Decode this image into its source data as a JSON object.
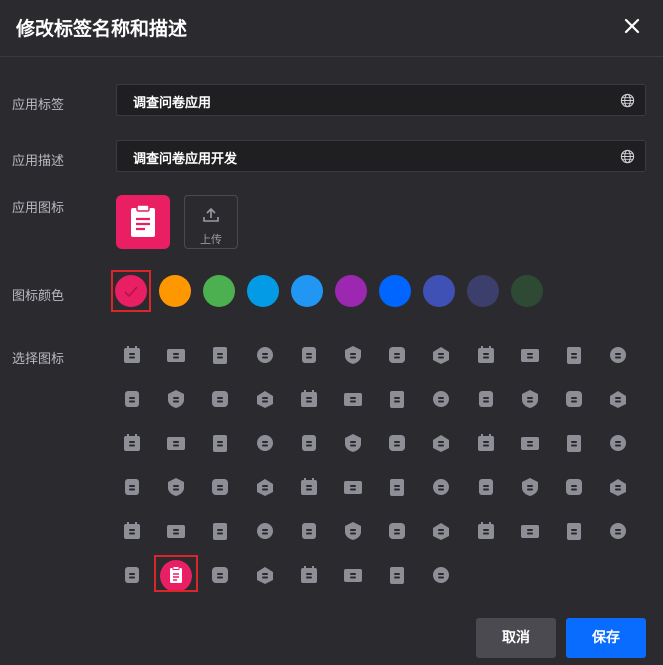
{
  "dialog": {
    "title": "修改标签名称和描述"
  },
  "fields": {
    "app_label": {
      "label": "应用标签",
      "value": "调查问卷应用"
    },
    "app_desc": {
      "label": "应用描述",
      "value": "调查问卷应用开发"
    },
    "app_icon": {
      "label": "应用图标",
      "upload_label": "上传"
    },
    "icon_color": {
      "label": "图标颜色"
    },
    "choose_icon": {
      "label": "选择图标"
    }
  },
  "colors": [
    "#e91e63",
    "#ff9800",
    "#4caf50",
    "#039be5",
    "#2196f3",
    "#9c27b0",
    "#0066ff",
    "#3f51b5",
    "#3c3f6b",
    "#2e4a34"
  ],
  "selected_color": "#e91e63",
  "icons": [
    "calendar-check",
    "id-card",
    "upload-box",
    "brain",
    "tablet-bell",
    "scan-frame",
    "bag",
    "code-window",
    "heart-shield",
    "layers-orbit",
    "mountains",
    "flower-grid",
    "pulse-monitor",
    "api",
    "leaf",
    "car-shield",
    "eye",
    "record-square",
    "globe-leaf",
    "shield-plant",
    "eye-hex",
    "cloud-chart",
    "cloud-toggle",
    "tree-circle",
    "cubes",
    "bookmark",
    "paper-plane",
    "chip",
    "trend-chart",
    "tag-hex",
    "tray",
    "layout",
    "database",
    "video",
    "document-check",
    "parking",
    "list",
    "cloud-download",
    "exchange",
    "life-ring",
    "document-list",
    "box-hex",
    "dollar-doc",
    "cloud-eye",
    "presentation",
    "phone",
    "star-person",
    "thumbs-up",
    "group",
    "syringe",
    "yen",
    "pie-chart",
    "handshake",
    "dumbbell",
    "bill",
    "chat-heart",
    "medical-kit",
    "certificate",
    "house",
    "bus",
    "orbit",
    "clipboard",
    "cube",
    "document-plus",
    "oa",
    "shield-plus",
    "airplane",
    "cloche"
  ],
  "selected_icon": "clipboard",
  "buttons": {
    "cancel": "取消",
    "save": "保存"
  }
}
